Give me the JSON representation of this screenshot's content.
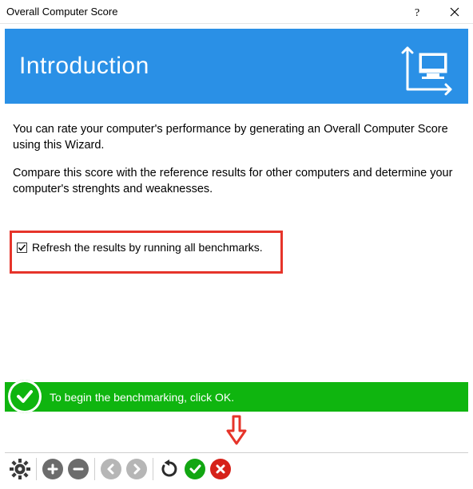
{
  "window": {
    "title": "Overall Computer Score"
  },
  "header": {
    "heading": "Introduction"
  },
  "body": {
    "p1": "You can rate your computer's performance by generating an Overall Computer Score using this Wizard.",
    "p2": "Compare this score with the reference results for other computers and determine your computer's strenghts and weaknesses.",
    "checkbox_label": "Refresh the results by running all benchmarks.",
    "checkbox_checked": true
  },
  "status": {
    "text": "To begin the benchmarking, click OK."
  },
  "toolbar": {
    "items": [
      "settings",
      "zoom-in",
      "zoom-out",
      "back",
      "forward",
      "refresh",
      "ok",
      "cancel"
    ]
  },
  "colors": {
    "header_bg": "#2a90e6",
    "highlight_border": "#e6342a",
    "status_bg": "#0fb50f",
    "ok_green": "#12a612",
    "cancel_red": "#d6221a"
  }
}
